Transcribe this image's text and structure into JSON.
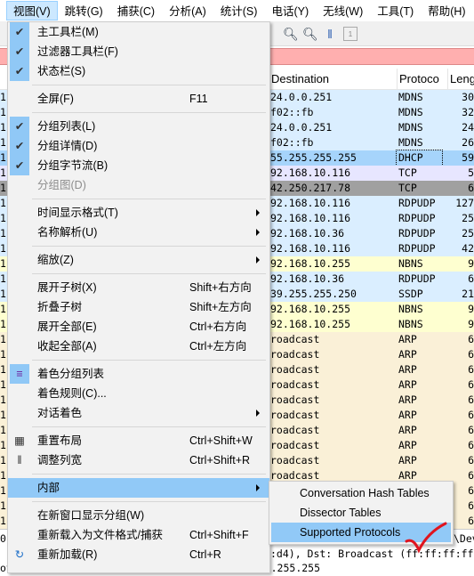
{
  "menubar": [
    "视图(V)",
    "跳转(G)",
    "捕获(C)",
    "分析(A)",
    "统计(S)",
    "电话(Y)",
    "无线(W)",
    "工具(T)",
    "帮助(H)"
  ],
  "columns": {
    "destination": "Destination",
    "protocol": "Protoco",
    "length": "Leng"
  },
  "rows": [
    {
      "no": "1",
      "dst": "24.0.0.251",
      "proto": "MDNS",
      "len": "30",
      "color": "#daeeff"
    },
    {
      "no": "1",
      "dst": "f02::fb",
      "proto": "MDNS",
      "len": "32",
      "color": "#daeeff"
    },
    {
      "no": "1",
      "dst": "24.0.0.251",
      "proto": "MDNS",
      "len": "24",
      "color": "#daeeff"
    },
    {
      "no": "1",
      "dst": "f02::fb",
      "proto": "MDNS",
      "len": "26",
      "color": "#daeeff"
    },
    {
      "no": "1",
      "dst": "55.255.255.255",
      "proto": "DHCP",
      "len": "59",
      "color": "#a6d4fb",
      "selected": true
    },
    {
      "no": "1",
      "dst": "92.168.10.116",
      "proto": "TCP",
      "len": "5",
      "color": "#e7e6ff"
    },
    {
      "no": "1",
      "dst": "42.250.217.78",
      "proto": "TCP",
      "len": "6",
      "color": "#a0a0a0"
    },
    {
      "no": "1",
      "dst": "92.168.10.116",
      "proto": "RDPUDP",
      "len": "127",
      "color": "#daeeff"
    },
    {
      "no": "1",
      "dst": "92.168.10.116",
      "proto": "RDPUDP",
      "len": "25",
      "color": "#daeeff"
    },
    {
      "no": "1",
      "dst": "92.168.10.36",
      "proto": "RDPUDP",
      "len": "25",
      "color": "#daeeff"
    },
    {
      "no": "1",
      "dst": "92.168.10.116",
      "proto": "RDPUDP",
      "len": "42",
      "color": "#daeeff"
    },
    {
      "no": "1",
      "dst": "92.168.10.255",
      "proto": "NBNS",
      "len": "9",
      "color": "#feffd0"
    },
    {
      "no": "1",
      "dst": "92.168.10.36",
      "proto": "RDPUDP",
      "len": "6",
      "color": "#daeeff"
    },
    {
      "no": "1",
      "dst": "39.255.255.250",
      "proto": "SSDP",
      "len": "21",
      "color": "#daeeff"
    },
    {
      "no": "1",
      "dst": "92.168.10.255",
      "proto": "NBNS",
      "len": "9",
      "color": "#feffd0"
    },
    {
      "no": "1",
      "dst": "92.168.10.255",
      "proto": "NBNS",
      "len": "9",
      "color": "#feffd0"
    },
    {
      "no": "1",
      "dst": "roadcast",
      "proto": "ARP",
      "len": "6",
      "color": "#faf0d7"
    },
    {
      "no": "1",
      "dst": "roadcast",
      "proto": "ARP",
      "len": "6",
      "color": "#faf0d7"
    },
    {
      "no": "1",
      "dst": "roadcast",
      "proto": "ARP",
      "len": "6",
      "color": "#faf0d7"
    },
    {
      "no": "1",
      "dst": "roadcast",
      "proto": "ARP",
      "len": "6",
      "color": "#faf0d7"
    },
    {
      "no": "1",
      "dst": "roadcast",
      "proto": "ARP",
      "len": "6",
      "color": "#faf0d7"
    },
    {
      "no": "1",
      "dst": "roadcast",
      "proto": "ARP",
      "len": "6",
      "color": "#faf0d7"
    },
    {
      "no": "1",
      "dst": "roadcast",
      "proto": "ARP",
      "len": "6",
      "color": "#faf0d7"
    },
    {
      "no": "1",
      "dst": "roadcast",
      "proto": "ARP",
      "len": "6",
      "color": "#faf0d7"
    },
    {
      "no": "1",
      "dst": "roadcast",
      "proto": "ARP",
      "len": "6",
      "color": "#faf0d7"
    },
    {
      "no": "1",
      "dst": "roadcast",
      "proto": "ARP",
      "len": "6",
      "color": "#faf0d7"
    },
    {
      "no": "1",
      "dst": "roadcast",
      "proto": "ARP",
      "len": "6",
      "color": "#faf0d7"
    },
    {
      "no": "1",
      "dst": "roadcast",
      "proto": "ARP",
      "len": "6",
      "color": "#faf0d7"
    },
    {
      "no": "1",
      "dst": "roadcast",
      "proto": "ARP",
      "len": "6",
      "color": "#faf0d7"
    }
  ],
  "detail": [
    "0",
    "\\Dev",
    ":d4), Dst: Broadcast (ff:ff:ff:ff",
    "otocol Version 4, Src: 0.0.0.0, Dst: 255.255.255.255"
  ],
  "menu": [
    {
      "label": "主工具栏(M)",
      "checked": true
    },
    {
      "label": "过滤器工具栏(F)",
      "checked": true
    },
    {
      "label": "状态栏(S)",
      "checked": true
    },
    {
      "sep": true
    },
    {
      "label": "全屏(F)",
      "shortcut": "F11"
    },
    {
      "sep": true
    },
    {
      "label": "分组列表(L)",
      "checked": true
    },
    {
      "label": "分组详情(D)",
      "checked": true
    },
    {
      "label": "分组字节流(B)",
      "checked": true
    },
    {
      "label": "分组图(D)",
      "disabled": true
    },
    {
      "sep": true
    },
    {
      "label": "时间显示格式(T)",
      "submenu": true
    },
    {
      "label": "名称解析(U)",
      "submenu": true
    },
    {
      "sep": true
    },
    {
      "label": "缩放(Z)",
      "submenu": true
    },
    {
      "sep": true
    },
    {
      "label": "展开子树(X)",
      "shortcut": "Shift+右方向"
    },
    {
      "label": "折叠子树",
      "shortcut": "Shift+左方向"
    },
    {
      "label": "展开全部(E)",
      "shortcut": "Ctrl+右方向"
    },
    {
      "label": "收起全部(A)",
      "shortcut": "Ctrl+左方向"
    },
    {
      "sep": true
    },
    {
      "label": "着色分组列表",
      "icon": "colorize-icon",
      "checked": true
    },
    {
      "label": "着色规则(C)..."
    },
    {
      "label": "对话着色",
      "submenu": true
    },
    {
      "sep": true
    },
    {
      "label": "重置布局",
      "shortcut": "Ctrl+Shift+W",
      "icon": "reset-layout-icon"
    },
    {
      "label": "调整列宽",
      "shortcut": "Ctrl+Shift+R",
      "icon": "resize-columns-icon"
    },
    {
      "sep": true
    },
    {
      "label": "内部",
      "submenu": true,
      "highlighted": true
    },
    {
      "sep": true
    },
    {
      "label": "在新窗口显示分组(W)"
    },
    {
      "label": "重新载入为文件格式/捕获",
      "shortcut": "Ctrl+Shift+F"
    },
    {
      "label": "重新加载(R)",
      "shortcut": "Ctrl+R",
      "icon": "reload-icon"
    }
  ],
  "submenu": [
    {
      "label": "Conversation Hash Tables"
    },
    {
      "label": "Dissector Tables"
    },
    {
      "label": "Supported Protocols",
      "highlighted": true
    }
  ],
  "annotation_color": "#e0141e"
}
